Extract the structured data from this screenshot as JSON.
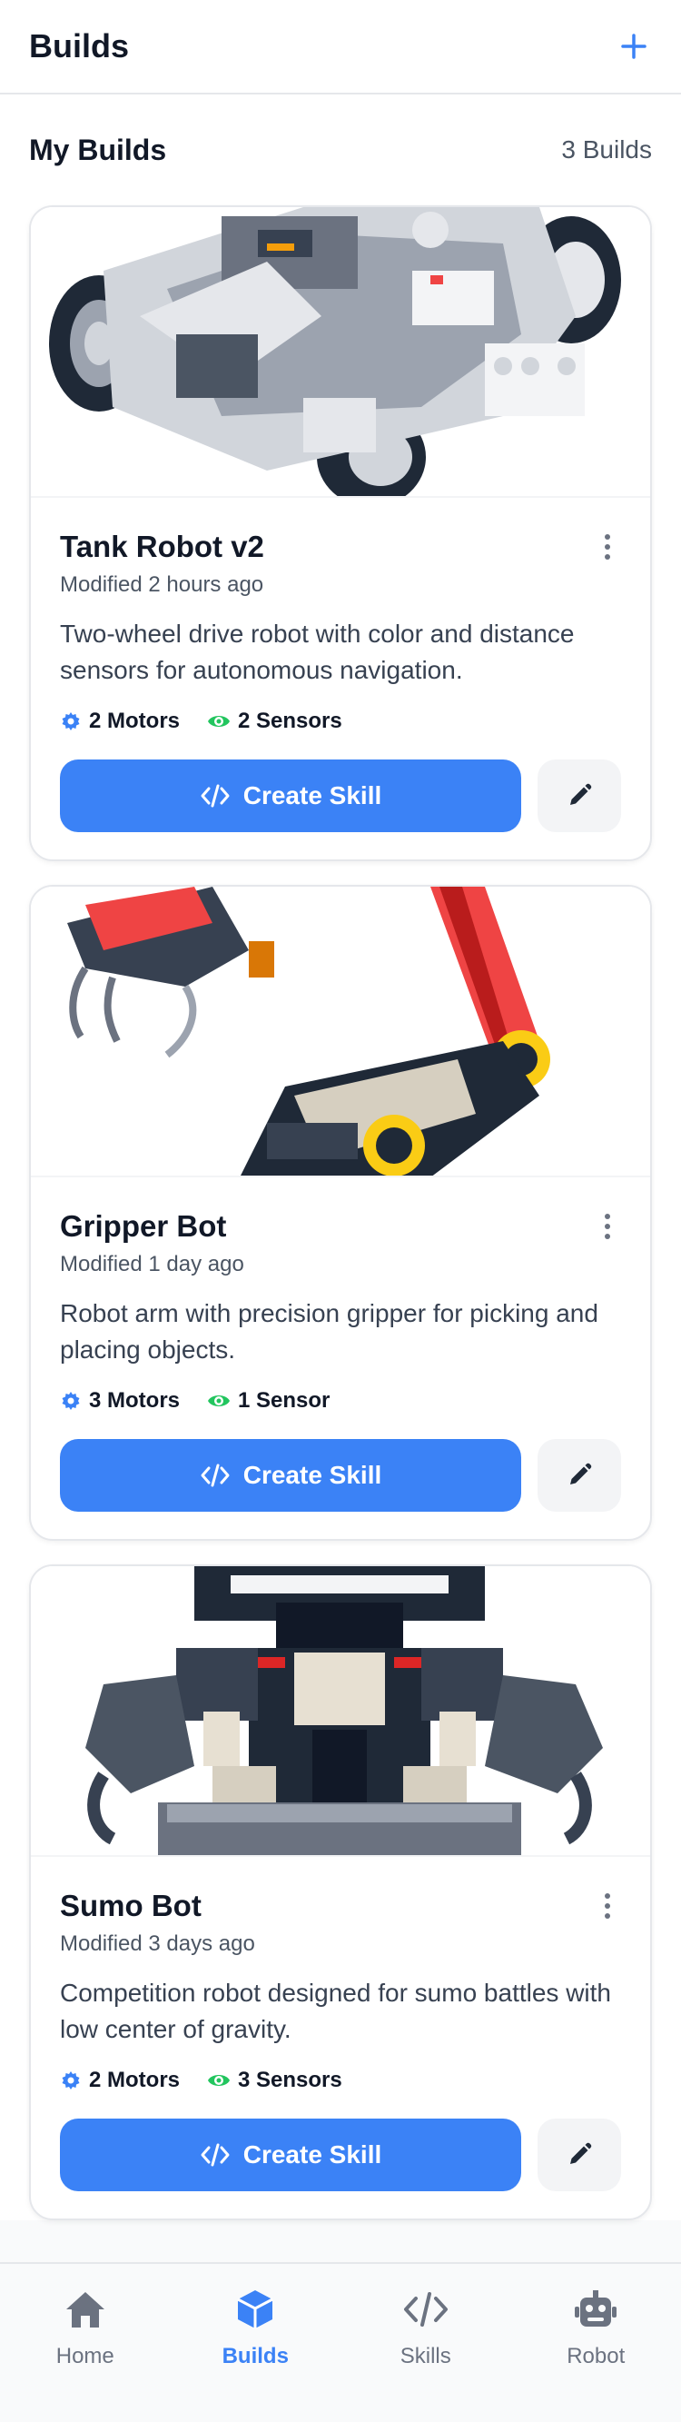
{
  "header": {
    "title": "Builds",
    "add_icon": "plus-icon"
  },
  "section": {
    "title": "My Builds",
    "count": "3 Builds"
  },
  "colors": {
    "accent": "#3b82f6",
    "sensor_icon": "#22c55e",
    "motor_icon": "#3b82f6"
  },
  "builds": [
    {
      "title": "Tank Robot v2",
      "modified": "Modified 2 hours ago",
      "description": "Two-wheel drive robot with color and distance sensors for autonomous navigation.",
      "motors": "2 Motors",
      "sensors": "2 Sensors",
      "cta": "Create Skill"
    },
    {
      "title": "Gripper Bot",
      "modified": "Modified 1 day ago",
      "description": "Robot arm with precision gripper for picking and placing objects.",
      "motors": "3 Motors",
      "sensors": "1 Sensor",
      "cta": "Create Skill"
    },
    {
      "title": "Sumo Bot",
      "modified": "Modified 3 days ago",
      "description": "Competition robot designed for sumo battles with low center of gravity.",
      "motors": "2 Motors",
      "sensors": "3 Sensors",
      "cta": "Create Skill"
    }
  ],
  "nav": [
    {
      "label": "Home",
      "icon": "home-icon",
      "active": false
    },
    {
      "label": "Builds",
      "icon": "cube-icon",
      "active": true
    },
    {
      "label": "Skills",
      "icon": "code-icon",
      "active": false
    },
    {
      "label": "Robot",
      "icon": "robot-icon",
      "active": false
    }
  ]
}
